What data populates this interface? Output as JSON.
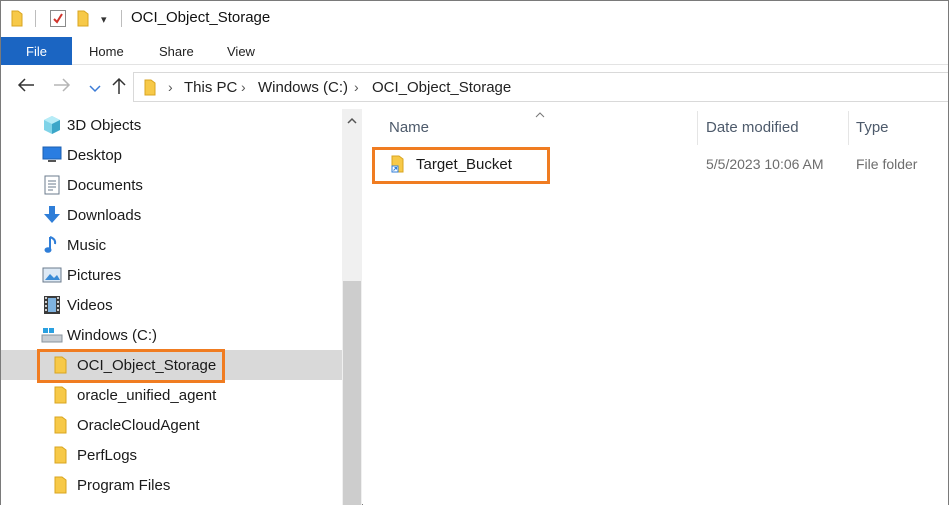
{
  "window": {
    "title": "OCI_Object_Storage"
  },
  "ribbon": {
    "tabs": [
      {
        "label": "File"
      },
      {
        "label": "Home"
      },
      {
        "label": "Share"
      },
      {
        "label": "View"
      }
    ]
  },
  "address": {
    "breadcrumbs": [
      {
        "label": "This PC"
      },
      {
        "label": "Windows (C:)"
      },
      {
        "label": "OCI_Object_Storage"
      }
    ]
  },
  "nav": {
    "items": [
      {
        "label": "3D Objects",
        "icon": "cube-3d-icon"
      },
      {
        "label": "Desktop",
        "icon": "desktop-icon"
      },
      {
        "label": "Documents",
        "icon": "documents-icon"
      },
      {
        "label": "Downloads",
        "icon": "download-arrow-icon"
      },
      {
        "label": "Music",
        "icon": "music-note-icon"
      },
      {
        "label": "Pictures",
        "icon": "pictures-icon"
      },
      {
        "label": "Videos",
        "icon": "film-icon"
      },
      {
        "label": "Windows (C:)",
        "icon": "drive-icon"
      },
      {
        "label": "OCI_Object_Storage",
        "icon": "folder-icon",
        "selected": true
      },
      {
        "label": "oracle_unified_agent",
        "icon": "folder-icon"
      },
      {
        "label": "OracleCloudAgent",
        "icon": "folder-icon"
      },
      {
        "label": "PerfLogs",
        "icon": "folder-icon"
      },
      {
        "label": "Program Files",
        "icon": "folder-icon"
      }
    ]
  },
  "content": {
    "columns": [
      {
        "label": "Name"
      },
      {
        "label": "Date modified"
      },
      {
        "label": "Type"
      }
    ],
    "rows": [
      {
        "name": "Target_Bucket",
        "date": "5/5/2023 10:06 AM",
        "type": "File folder",
        "icon": "folder-shortcut-icon"
      }
    ]
  },
  "colors": {
    "accent": "#1b65c2",
    "highlight": "#f07c21",
    "selection": "#d9d9d9",
    "folder": "#f7c948"
  }
}
